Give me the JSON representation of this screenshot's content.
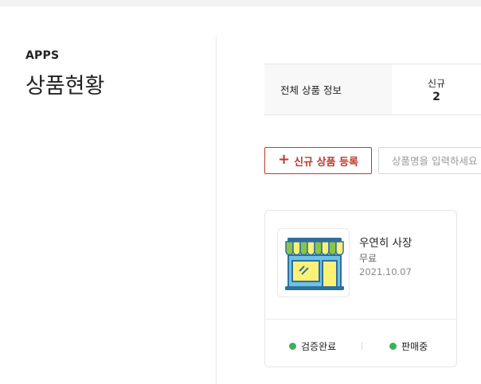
{
  "sidebar": {
    "section": "APPS",
    "title": "상품현황"
  },
  "summary": {
    "heading": "전체 상품 정보",
    "new_label": "신규",
    "new_count": "2"
  },
  "toolbar": {
    "new_button_label": "신규 상품 등록",
    "search_placeholder": "상품명을 입력하세요"
  },
  "product": {
    "name": "우연히 사장",
    "price": "무료",
    "date": "2021.10.07",
    "verify_status": "검증완료",
    "sale_status": "판매중",
    "icon": "shop-storefront-icon",
    "status_color": "#3fae5f"
  },
  "colors": {
    "accent": "#c0392b"
  }
}
